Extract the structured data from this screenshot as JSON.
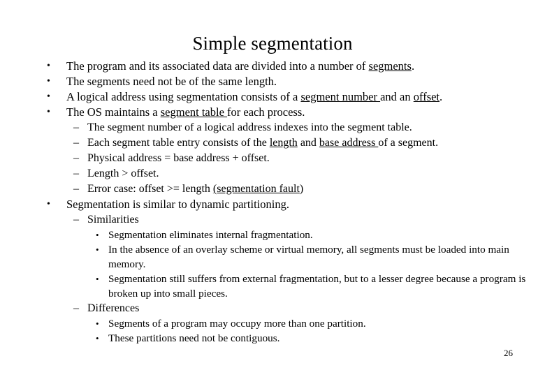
{
  "slide": {
    "title": "Simple segmentation",
    "page_number": "26",
    "bullet_marker_level1": "•",
    "bullet_marker_level2": "–",
    "bullet_marker_level3": "•",
    "background_color": "#ffffff",
    "text_color": "#000000"
  },
  "content": {
    "b1": {
      "pre": "The program and its associated data are divided into a number of ",
      "underlined": "segments",
      "post": "."
    },
    "b2": {
      "text": "The segments need not be of the same length."
    },
    "b3": {
      "pre": "A logical address using segmentation consists of a ",
      "underlined1": "segment number ",
      "mid": "and an ",
      "underlined2": "offset",
      "post": "."
    },
    "b4": {
      "pre": "The OS maintains a ",
      "underlined": "segment table ",
      "post": "for each process."
    },
    "s1": {
      "text": "The segment number of a logical address indexes into the segment table."
    },
    "s2": {
      "pre": "Each segment table entry consists of the ",
      "underlined1": "length",
      "mid": " and ",
      "underlined2": "base address ",
      "post": "of a segment."
    },
    "s3": {
      "text": "Physical address = base address + offset."
    },
    "s4": {
      "text": "Length > offset."
    },
    "s5": {
      "pre": "Error case: offset >= length ",
      "underlined": "(segmentation fault",
      "post": ")"
    },
    "b5": {
      "text": "Segmentation is similar to dynamic partitioning."
    },
    "sim_head": {
      "text": "Similarities"
    },
    "sim1": {
      "text": "Segmentation eliminates internal fragmentation."
    },
    "sim2": {
      "text": "In the absence of an overlay scheme or virtual memory, all segments must be loaded into main memory."
    },
    "sim3": {
      "text": "Segmentation still suffers from external fragmentation, but to a lesser degree because a program is broken up into small pieces."
    },
    "diff_head": {
      "text": "Differences"
    },
    "diff1": {
      "text": "Segments of a program may occupy more than one partition."
    },
    "diff2": {
      "text": "These partitions need not be contiguous."
    }
  }
}
